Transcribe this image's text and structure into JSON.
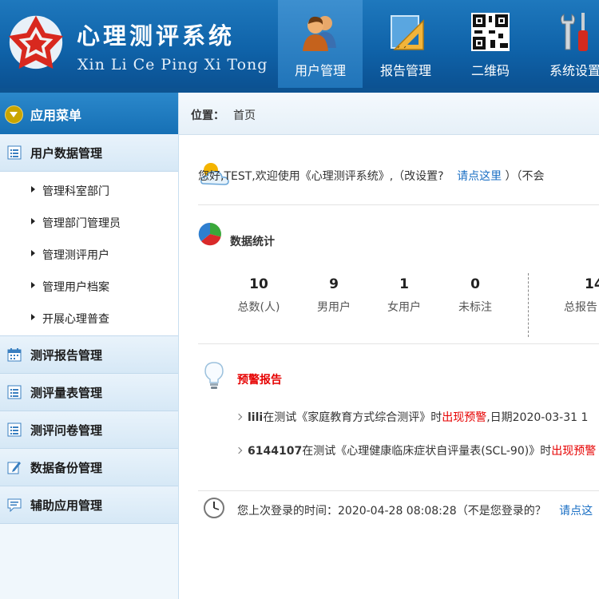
{
  "header": {
    "title": "心理测评系统",
    "subtitle": "Xin Li Ce Ping Xi Tong",
    "nav": [
      {
        "label": "用户管理",
        "icon": "users-icon",
        "active": true
      },
      {
        "label": "报告管理",
        "icon": "ruler-triangle-icon",
        "active": false
      },
      {
        "label": "二维码",
        "icon": "qrcode-icon",
        "active": false
      },
      {
        "label": "系统设置",
        "icon": "tools-icon",
        "active": false
      }
    ]
  },
  "sidebar": {
    "title": "应用菜单",
    "groups": [
      {
        "label": "用户数据管理",
        "icon": "list-icon",
        "items": [
          "管理科室部门",
          "管理部门管理员",
          "管理测评用户",
          "管理用户档案",
          "开展心理普查"
        ]
      },
      {
        "label": "测评报告管理",
        "icon": "calendar-icon"
      },
      {
        "label": "测评量表管理",
        "icon": "list-icon"
      },
      {
        "label": "测评问卷管理",
        "icon": "list-icon"
      },
      {
        "label": "数据备份管理",
        "icon": "edit-icon"
      },
      {
        "label": "辅助应用管理",
        "icon": "chat-icon"
      }
    ]
  },
  "breadcrumb": {
    "label": "位置：",
    "value": "首页"
  },
  "welcome": {
    "prefix": "您好,TEST,欢迎使用《心理测评系统》,（改设置?",
    "link": "请点这里",
    "suffix": "）（不会"
  },
  "stats": {
    "title": "数据统计",
    "items": [
      {
        "value": "10",
        "label": "总数(人)"
      },
      {
        "value": "9",
        "label": "男用户"
      },
      {
        "value": "1",
        "label": "女用户"
      },
      {
        "value": "0",
        "label": "未标注"
      },
      {
        "value": "14",
        "label": "总报告"
      }
    ]
  },
  "warnings": {
    "title": "预警报告",
    "items": [
      {
        "user": "lili",
        "pre": "在测试《家庭教育方式综合测评》时",
        "alert": "出现预警",
        "post": ",日期2020-03-31 1"
      },
      {
        "user": "6144107",
        "pre": "在测试《心理健康临床症状自评量表(SCL-90)》时",
        "alert": "出现预警",
        "post": ""
      }
    ]
  },
  "last_login": {
    "text": "您上次登录的时间：2020-04-28 08:08:28（不是您登录的？",
    "link": "请点这"
  }
}
